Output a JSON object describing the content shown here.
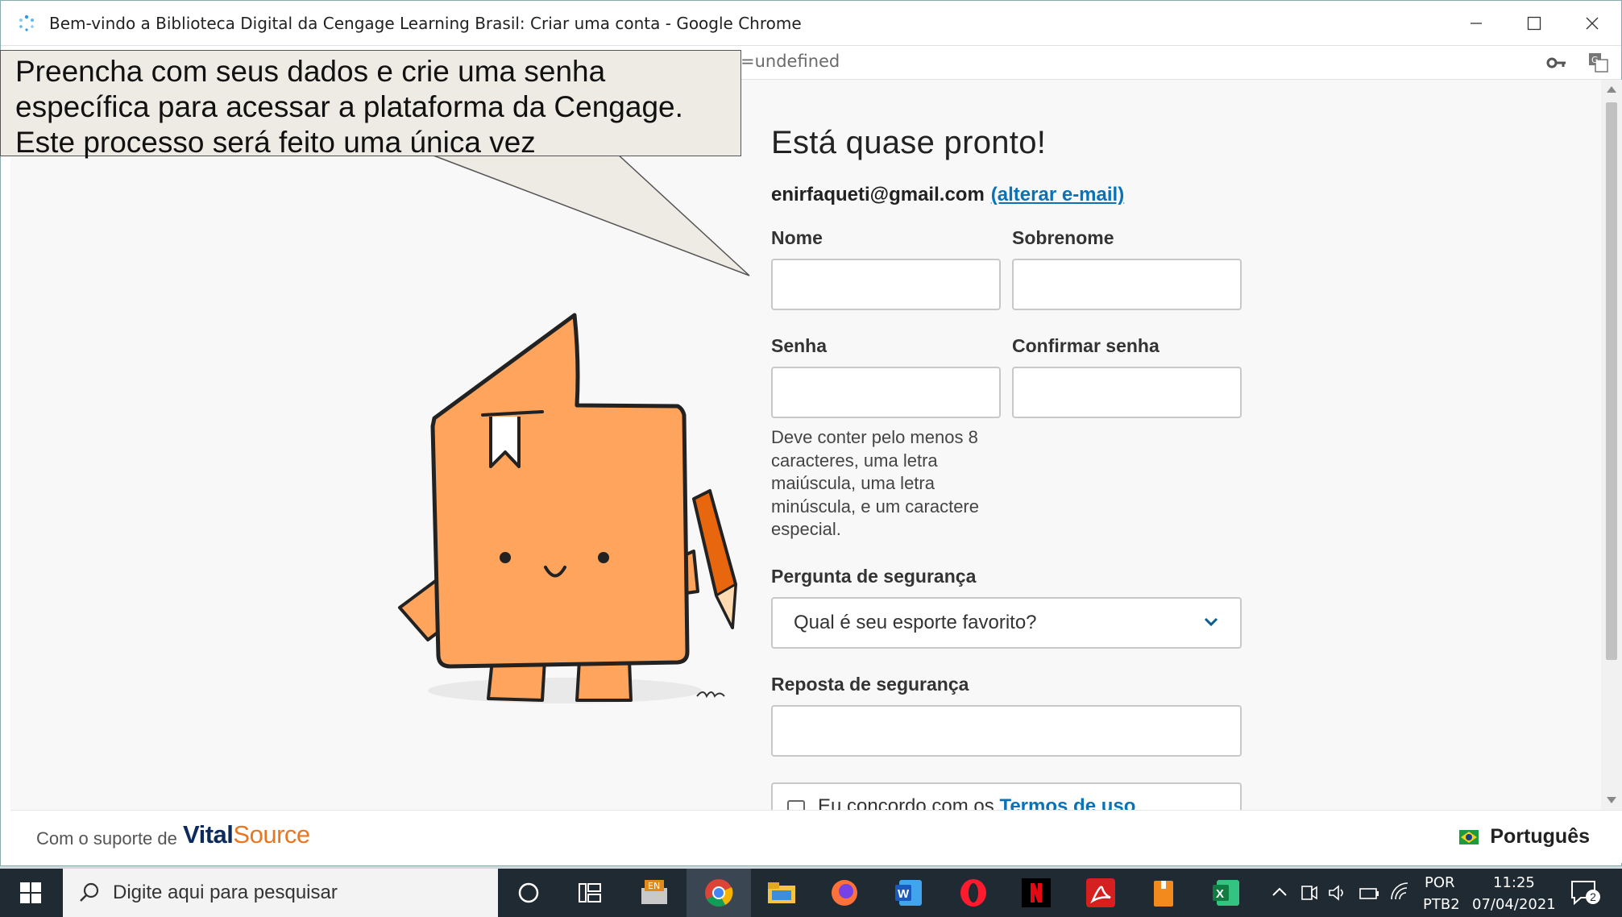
{
  "window": {
    "title": "Bem-vindo a Biblioteca Digital da Cengage Learning Brasil: Criar uma conta - Google Chrome",
    "url_fragment": "=undefined"
  },
  "callout": {
    "line1": "Preencha com seus dados e crie uma senha",
    "line2": "específica para acessar a plataforma da Cengage.",
    "line3": "Este processo será feito uma única vez"
  },
  "form": {
    "heading": "Está quase pronto!",
    "email": "enirfaqueti@gmail.com",
    "change_email_link": "(alterar e-mail)",
    "first_name_label": "Nome",
    "last_name_label": "Sobrenome",
    "password_label": "Senha",
    "confirm_password_label": "Confirmar senha",
    "password_hint": [
      "Deve conter pelo menos 8",
      "caracteres, uma letra",
      "maiúscula, uma letra",
      "minúscula, e um caractere",
      "especial."
    ],
    "security_question_label": "Pergunta de segurança",
    "security_question_value": "Qual é seu esporte favorito?",
    "security_answer_label": "Reposta de segurança",
    "terms_prefix": "Eu concordo com os",
    "terms_link": "Termos de uso"
  },
  "footer": {
    "powered_by": "Com o suporte de",
    "brand_vital": "Vital",
    "brand_source": "Source",
    "language": "Português"
  },
  "taskbar": {
    "search_placeholder": "Digite aqui para pesquisar",
    "lang_top": "POR",
    "lang_bottom": "PTB2",
    "time": "11:25",
    "date": "07/04/2021",
    "notification_count": "2",
    "en_badge": "EN"
  },
  "colors": {
    "link": "#0b72b5",
    "mascot_orange": "#ffa45c",
    "callout_bg": "#eeebe4"
  }
}
